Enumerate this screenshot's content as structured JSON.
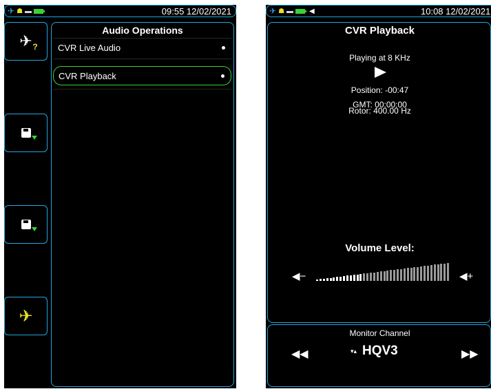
{
  "screen_a": {
    "status": {
      "time": "09:55 12/02/2021",
      "icons": [
        "plane-icon",
        "network-icon",
        "usb-icon",
        "battery-icon"
      ]
    },
    "side_buttons": [
      {
        "name": "aircraft-query-button",
        "icon": "plane-question-icon"
      },
      {
        "name": "save-download-button-1",
        "icon": "disk-download-icon"
      },
      {
        "name": "save-download-button-2",
        "icon": "disk-download-icon"
      },
      {
        "name": "aircraft-button",
        "icon": "plane-icon",
        "color": "#e6e02a"
      }
    ],
    "panel": {
      "title": "Audio Operations",
      "items": [
        {
          "label": "CVR Live Audio",
          "selected": false
        },
        {
          "label": "CVR Playback",
          "selected": true
        }
      ]
    }
  },
  "screen_b": {
    "status": {
      "time": "10:08 12/02/2021",
      "icons": [
        "plane-icon",
        "network-icon",
        "usb-icon",
        "battery-icon",
        "speaker-icon"
      ]
    },
    "playback": {
      "title": "CVR Playback",
      "playing": "Playing at 8 KHz",
      "position": "Position: -00:47",
      "gmt": "GMT: 00:00:00",
      "rotor": "Rotor: 400.00 Hz"
    },
    "volume": {
      "label": "Volume Level:",
      "level_fraction": 0.35,
      "bar_count": 40
    },
    "monitor": {
      "label": "Monitor Channel",
      "channel": "HQV3"
    }
  },
  "colors": {
    "accent_border": "#23a7e0",
    "selected": "#3ad13a",
    "yellow": "#e6e02a",
    "background": "#000000"
  }
}
